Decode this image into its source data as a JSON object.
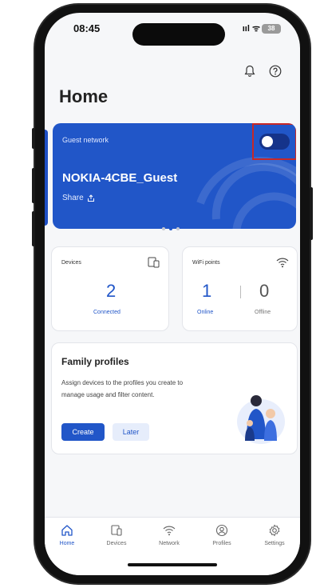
{
  "status": {
    "time": "08:45",
    "signal": "ııl ᯤ",
    "battery": "38"
  },
  "header": {
    "title": "Home"
  },
  "guest_card": {
    "label": "Guest network",
    "ssid": "NOKIA-4CBE_Guest",
    "share_label": "Share",
    "toggle_on": false
  },
  "carousel": {
    "pages": 3,
    "active_index": 1
  },
  "devices_card": {
    "label": "Devices",
    "count": "2",
    "sub_label": "Connected"
  },
  "wifi_card": {
    "label": "WiFi points",
    "online_count": "1",
    "online_label": "Online",
    "offline_count": "0",
    "offline_label": "Offline"
  },
  "family_card": {
    "title": "Family profiles",
    "description": "Assign devices to the profiles you create to manage usage and filter content.",
    "create_label": "Create",
    "later_label": "Later"
  },
  "bottom_nav": {
    "items": [
      {
        "label": "Home",
        "icon": "home-icon"
      },
      {
        "label": "Devices",
        "icon": "devices-icon"
      },
      {
        "label": "Network",
        "icon": "wifi-icon"
      },
      {
        "label": "Profiles",
        "icon": "profile-icon"
      },
      {
        "label": "Settings",
        "icon": "settings-icon"
      }
    ],
    "active": "Home"
  },
  "colors": {
    "primary": "#2156c8",
    "highlight": "#c62828",
    "background": "#f6f7f9"
  }
}
